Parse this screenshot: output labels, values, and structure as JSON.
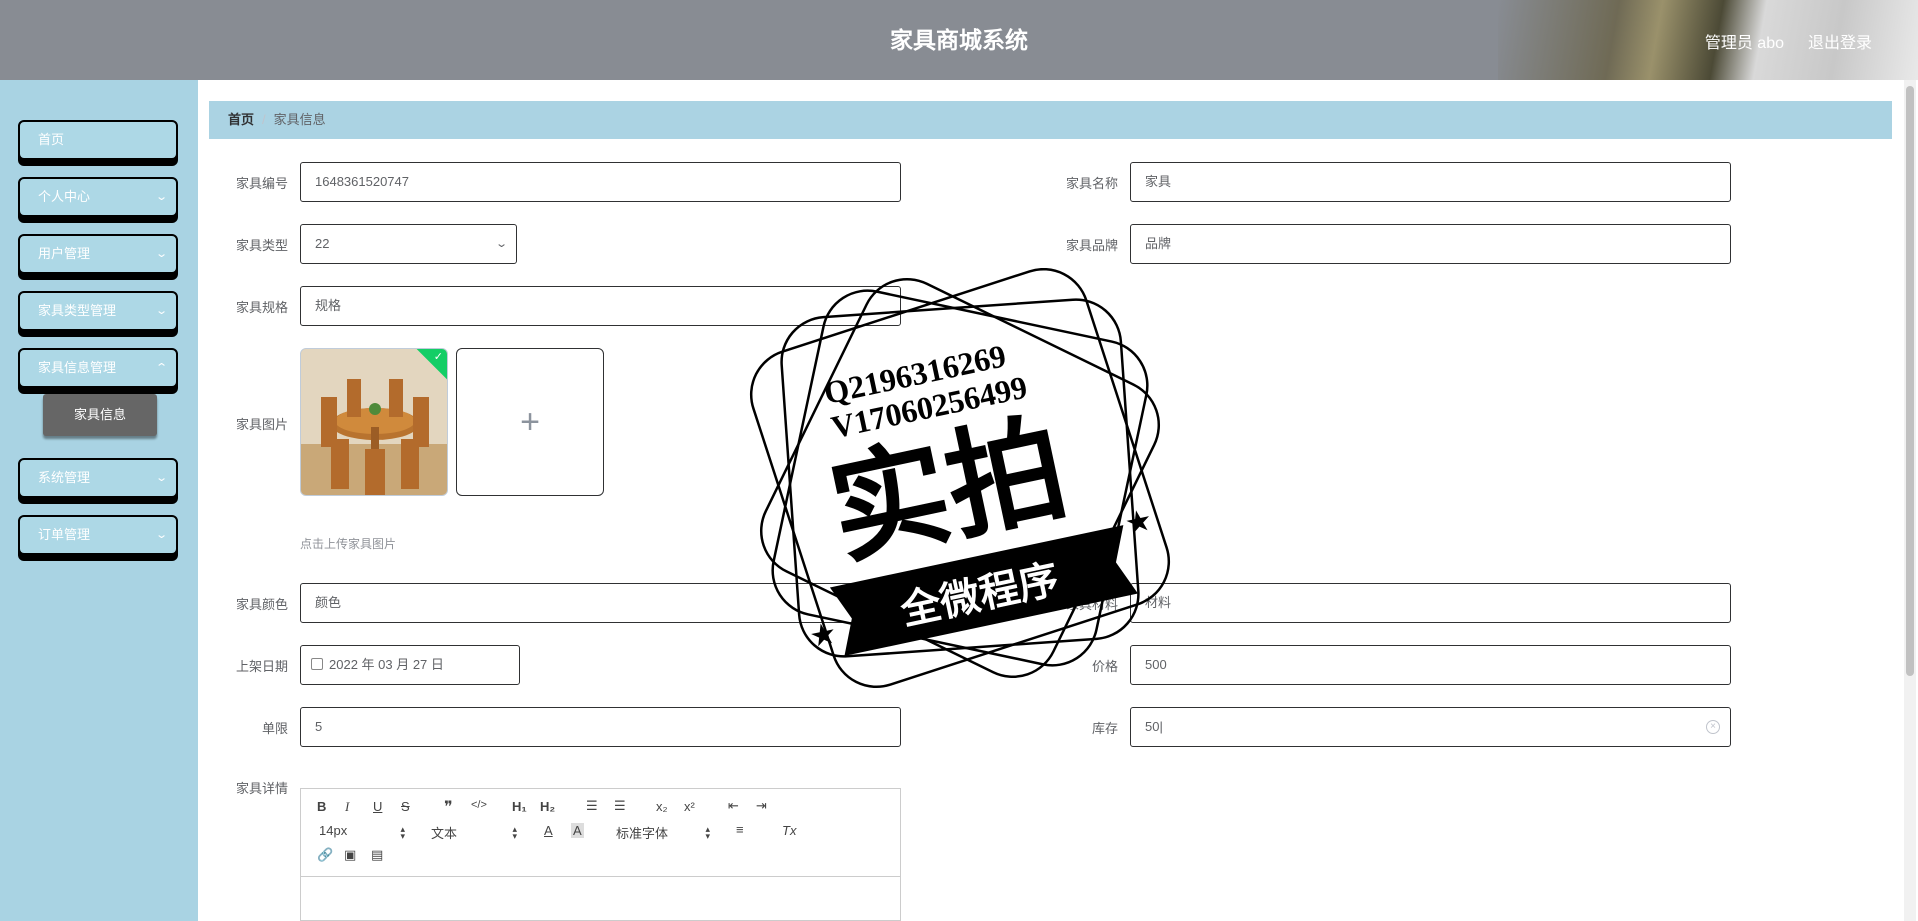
{
  "header": {
    "title": "家具商城系统",
    "user": "管理员 abo",
    "logout": "退出登录"
  },
  "sidebar": {
    "items": [
      {
        "label": "首页",
        "has_children": false
      },
      {
        "label": "个人中心",
        "has_children": true
      },
      {
        "label": "用户管理",
        "has_children": true
      },
      {
        "label": "家具类型管理",
        "has_children": true
      },
      {
        "label": "家具信息管理",
        "has_children": true
      },
      {
        "label": "系统管理",
        "has_children": true
      },
      {
        "label": "订单管理",
        "has_children": true
      }
    ],
    "sub_item": "家具信息"
  },
  "breadcrumb": {
    "home": "首页",
    "separator": "/",
    "current": "家具信息"
  },
  "form": {
    "code": {
      "label": "家具编号",
      "value": "1648361520747"
    },
    "name": {
      "label": "家具名称",
      "value": "家具"
    },
    "type": {
      "label": "家具类型",
      "value": "22"
    },
    "brand": {
      "label": "家具品牌",
      "value": "品牌"
    },
    "spec": {
      "label": "家具规格",
      "value": "规格"
    },
    "image": {
      "label": "家具图片",
      "tip": "点击上传家具图片",
      "add": "+"
    },
    "color": {
      "label": "家具颜色",
      "value": "颜色"
    },
    "material": {
      "label": "家具材料",
      "value": "材料"
    },
    "date": {
      "label": "上架日期",
      "value": "2022 年 03 月 27 日"
    },
    "price": {
      "label": "价格",
      "value": "500"
    },
    "limit": {
      "label": "单限",
      "value": "5"
    },
    "stock": {
      "label": "库存",
      "value": "50"
    },
    "detail": {
      "label": "家具详情"
    }
  },
  "editor": {
    "font_size": "14px",
    "block_type": "文本",
    "font_family": "标准字体",
    "buttons": {
      "bold": "B",
      "italic": "I",
      "underline": "U",
      "strike": "S",
      "quote": "❞",
      "code": "</>",
      "h1": "H₁",
      "h2": "H₂",
      "sub": "x₂",
      "sup": "x²",
      "clear": "Tx"
    }
  },
  "watermark": {
    "line1": "Q2196316269",
    "line2": "V17060256499",
    "main": "实拍",
    "ribbon": "全微程序"
  },
  "colors": {
    "header": "#888c93",
    "sidebar": "#a9d3e3",
    "menu_item": "#add8e6",
    "active_sub": "#666666",
    "breadcrumb": "#abd3e3"
  }
}
